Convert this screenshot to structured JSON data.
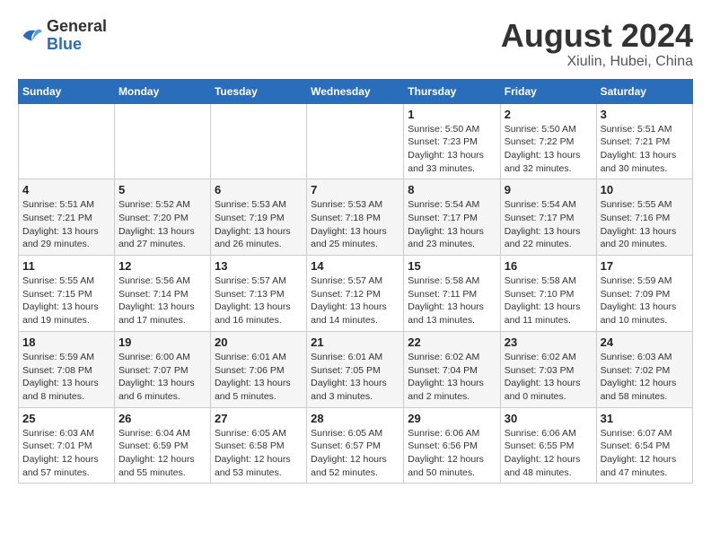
{
  "header": {
    "logo_general": "General",
    "logo_blue": "Blue",
    "title": "August 2024",
    "subtitle": "Xiulin, Hubei, China"
  },
  "calendar": {
    "days_of_week": [
      "Sunday",
      "Monday",
      "Tuesday",
      "Wednesday",
      "Thursday",
      "Friday",
      "Saturday"
    ],
    "weeks": [
      [
        {
          "day": "",
          "info": ""
        },
        {
          "day": "",
          "info": ""
        },
        {
          "day": "",
          "info": ""
        },
        {
          "day": "",
          "info": ""
        },
        {
          "day": "1",
          "info": "Sunrise: 5:50 AM\nSunset: 7:23 PM\nDaylight: 13 hours\nand 33 minutes."
        },
        {
          "day": "2",
          "info": "Sunrise: 5:50 AM\nSunset: 7:22 PM\nDaylight: 13 hours\nand 32 minutes."
        },
        {
          "day": "3",
          "info": "Sunrise: 5:51 AM\nSunset: 7:21 PM\nDaylight: 13 hours\nand 30 minutes."
        }
      ],
      [
        {
          "day": "4",
          "info": "Sunrise: 5:51 AM\nSunset: 7:21 PM\nDaylight: 13 hours\nand 29 minutes."
        },
        {
          "day": "5",
          "info": "Sunrise: 5:52 AM\nSunset: 7:20 PM\nDaylight: 13 hours\nand 27 minutes."
        },
        {
          "day": "6",
          "info": "Sunrise: 5:53 AM\nSunset: 7:19 PM\nDaylight: 13 hours\nand 26 minutes."
        },
        {
          "day": "7",
          "info": "Sunrise: 5:53 AM\nSunset: 7:18 PM\nDaylight: 13 hours\nand 25 minutes."
        },
        {
          "day": "8",
          "info": "Sunrise: 5:54 AM\nSunset: 7:17 PM\nDaylight: 13 hours\nand 23 minutes."
        },
        {
          "day": "9",
          "info": "Sunrise: 5:54 AM\nSunset: 7:17 PM\nDaylight: 13 hours\nand 22 minutes."
        },
        {
          "day": "10",
          "info": "Sunrise: 5:55 AM\nSunset: 7:16 PM\nDaylight: 13 hours\nand 20 minutes."
        }
      ],
      [
        {
          "day": "11",
          "info": "Sunrise: 5:55 AM\nSunset: 7:15 PM\nDaylight: 13 hours\nand 19 minutes."
        },
        {
          "day": "12",
          "info": "Sunrise: 5:56 AM\nSunset: 7:14 PM\nDaylight: 13 hours\nand 17 minutes."
        },
        {
          "day": "13",
          "info": "Sunrise: 5:57 AM\nSunset: 7:13 PM\nDaylight: 13 hours\nand 16 minutes."
        },
        {
          "day": "14",
          "info": "Sunrise: 5:57 AM\nSunset: 7:12 PM\nDaylight: 13 hours\nand 14 minutes."
        },
        {
          "day": "15",
          "info": "Sunrise: 5:58 AM\nSunset: 7:11 PM\nDaylight: 13 hours\nand 13 minutes."
        },
        {
          "day": "16",
          "info": "Sunrise: 5:58 AM\nSunset: 7:10 PM\nDaylight: 13 hours\nand 11 minutes."
        },
        {
          "day": "17",
          "info": "Sunrise: 5:59 AM\nSunset: 7:09 PM\nDaylight: 13 hours\nand 10 minutes."
        }
      ],
      [
        {
          "day": "18",
          "info": "Sunrise: 5:59 AM\nSunset: 7:08 PM\nDaylight: 13 hours\nand 8 minutes."
        },
        {
          "day": "19",
          "info": "Sunrise: 6:00 AM\nSunset: 7:07 PM\nDaylight: 13 hours\nand 6 minutes."
        },
        {
          "day": "20",
          "info": "Sunrise: 6:01 AM\nSunset: 7:06 PM\nDaylight: 13 hours\nand 5 minutes."
        },
        {
          "day": "21",
          "info": "Sunrise: 6:01 AM\nSunset: 7:05 PM\nDaylight: 13 hours\nand 3 minutes."
        },
        {
          "day": "22",
          "info": "Sunrise: 6:02 AM\nSunset: 7:04 PM\nDaylight: 13 hours\nand 2 minutes."
        },
        {
          "day": "23",
          "info": "Sunrise: 6:02 AM\nSunset: 7:03 PM\nDaylight: 13 hours\nand 0 minutes."
        },
        {
          "day": "24",
          "info": "Sunrise: 6:03 AM\nSunset: 7:02 PM\nDaylight: 12 hours\nand 58 minutes."
        }
      ],
      [
        {
          "day": "25",
          "info": "Sunrise: 6:03 AM\nSunset: 7:01 PM\nDaylight: 12 hours\nand 57 minutes."
        },
        {
          "day": "26",
          "info": "Sunrise: 6:04 AM\nSunset: 6:59 PM\nDaylight: 12 hours\nand 55 minutes."
        },
        {
          "day": "27",
          "info": "Sunrise: 6:05 AM\nSunset: 6:58 PM\nDaylight: 12 hours\nand 53 minutes."
        },
        {
          "day": "28",
          "info": "Sunrise: 6:05 AM\nSunset: 6:57 PM\nDaylight: 12 hours\nand 52 minutes."
        },
        {
          "day": "29",
          "info": "Sunrise: 6:06 AM\nSunset: 6:56 PM\nDaylight: 12 hours\nand 50 minutes."
        },
        {
          "day": "30",
          "info": "Sunrise: 6:06 AM\nSunset: 6:55 PM\nDaylight: 12 hours\nand 48 minutes."
        },
        {
          "day": "31",
          "info": "Sunrise: 6:07 AM\nSunset: 6:54 PM\nDaylight: 12 hours\nand 47 minutes."
        }
      ]
    ]
  }
}
